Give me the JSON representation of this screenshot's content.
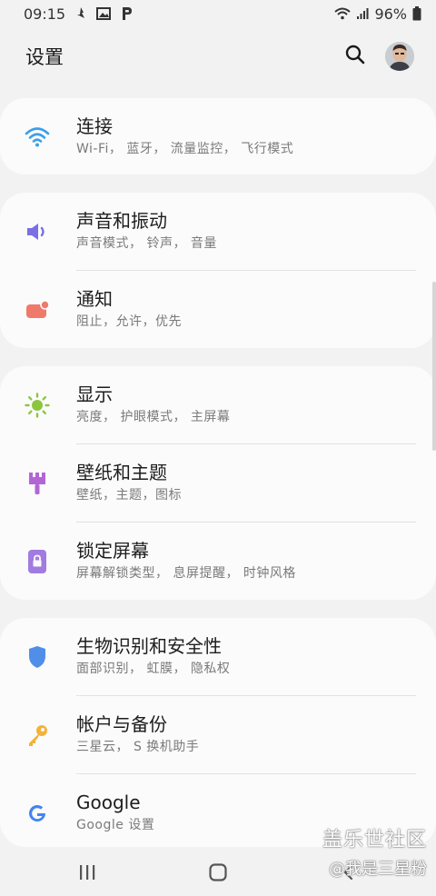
{
  "status_bar": {
    "time": "09:15",
    "battery": "96%",
    "left_icons": [
      "notification-icon",
      "gallery-icon",
      "p-icon"
    ],
    "right_icons": [
      "wifi-icon",
      "signal-icon",
      "battery-icon"
    ]
  },
  "header": {
    "title": "设置",
    "search_icon": "search-icon",
    "avatar": "avatar"
  },
  "sections": [
    {
      "items": [
        {
          "title": "连接",
          "subtitle": "Wi-Fi， 蓝牙， 流量监控， 飞行模式",
          "icon": "wifi-icon",
          "color": "#3aa0e8"
        }
      ]
    },
    {
      "items": [
        {
          "title": "声音和振动",
          "subtitle": "声音模式， 铃声， 音量",
          "icon": "volume-icon",
          "color": "#7b6fe3"
        },
        {
          "title": "通知",
          "subtitle": "阻止，允许，优先",
          "icon": "notification-icon",
          "color": "#ef7a6c"
        }
      ]
    },
    {
      "items": [
        {
          "title": "显示",
          "subtitle": "亮度， 护眼模式， 主屏幕",
          "icon": "brightness-icon",
          "color": "#8cc63e"
        },
        {
          "title": "壁纸和主题",
          "subtitle": "壁纸，主题，图标",
          "icon": "brush-icon",
          "color": "#b266d6"
        },
        {
          "title": "锁定屏幕",
          "subtitle": "屏幕解锁类型， 息屏提醒， 时钟风格",
          "icon": "lock-icon",
          "color": "#a27be0"
        }
      ]
    },
    {
      "items": [
        {
          "title": "生物识别和安全性",
          "subtitle": "面部识别， 虹膜， 隐私权",
          "icon": "shield-icon",
          "color": "#4f8fe8"
        },
        {
          "title": "帐户与备份",
          "subtitle": "三星云， S 换机助手",
          "icon": "key-icon",
          "color": "#f3b23a"
        },
        {
          "title": "Google",
          "subtitle": "Google 设置",
          "icon": "google-icon",
          "color": "#4285f4"
        }
      ]
    }
  ],
  "nav": {
    "recents": "recents-icon",
    "home": "home-icon",
    "back": "back-icon"
  },
  "watermark": {
    "line1": "盖乐世社区",
    "line2": "@我是三星粉"
  }
}
